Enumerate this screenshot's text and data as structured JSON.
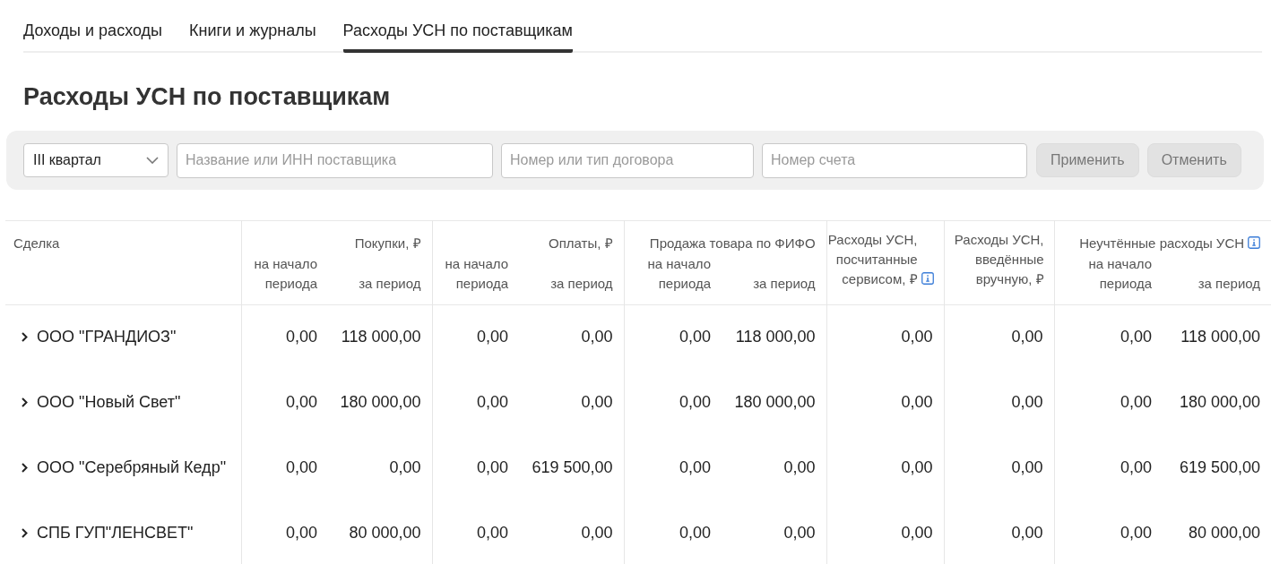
{
  "tabs": [
    {
      "label": "Доходы и расходы",
      "selected": false
    },
    {
      "label": "Книги и журналы",
      "selected": false
    },
    {
      "label": "Расходы УСН по поставщикам",
      "selected": true
    }
  ],
  "title": "Расходы УСН по поставщикам",
  "filters": {
    "period": {
      "value": "III квартал"
    },
    "fields": [
      {
        "placeholder": "Название или ИНН поставщика"
      },
      {
        "placeholder": "Номер или тип договора"
      },
      {
        "placeholder": "Номер счета"
      }
    ],
    "buttons": [
      {
        "label": "Применить",
        "disabled": true
      },
      {
        "label": "Отменить",
        "disabled": true
      }
    ]
  },
  "table": {
    "columns": [
      {
        "label": "Сделка",
        "kind": "name"
      },
      {
        "label": "Покупки, ₽",
        "kind": "group",
        "subcolumns": [
          "на начало периода",
          "за период"
        ]
      },
      {
        "label": "Оплаты, ₽",
        "kind": "group",
        "subcolumns": [
          "на начало периода",
          "за период"
        ]
      },
      {
        "label": "Продажа товара по ФИФО",
        "kind": "group",
        "subcolumns": [
          "на начало периода",
          "за период"
        ]
      },
      {
        "label": "Расходы УСН, посчитанные сервисом, ₽",
        "kind": "single",
        "info": true
      },
      {
        "label": "Расходы УСН, введённые вручную, ₽",
        "kind": "single",
        "info": false
      },
      {
        "label": "Неучтённые расходы УСН",
        "kind": "group",
        "info": true,
        "subcolumns": [
          "на начало периода",
          "за период"
        ]
      }
    ],
    "rows": [
      {
        "name": "ООО \"ГРАНДИОЗ\"",
        "expanded": false,
        "values": [
          "0,00",
          "118 000,00",
          "0,00",
          "0,00",
          "0,00",
          "118 000,00",
          "0,00",
          "0,00",
          "0,00",
          "118 000,00"
        ]
      },
      {
        "name": "ООО \"Новый Свет\"",
        "expanded": false,
        "values": [
          "0,00",
          "180 000,00",
          "0,00",
          "0,00",
          "0,00",
          "180 000,00",
          "0,00",
          "0,00",
          "0,00",
          "180 000,00"
        ]
      },
      {
        "name": "ООО \"Серебряный Кедр\"",
        "expanded": false,
        "values": [
          "0,00",
          "0,00",
          "0,00",
          "619 500,00",
          "0,00",
          "0,00",
          "0,00",
          "0,00",
          "0,00",
          "619 500,00"
        ]
      },
      {
        "name": "СПБ ГУП\"ЛЕНСВЕТ\"",
        "expanded": false,
        "values": [
          "0,00",
          "80 000,00",
          "0,00",
          "0,00",
          "0,00",
          "0,00",
          "0,00",
          "0,00",
          "0,00",
          "80 000,00"
        ]
      }
    ]
  }
}
